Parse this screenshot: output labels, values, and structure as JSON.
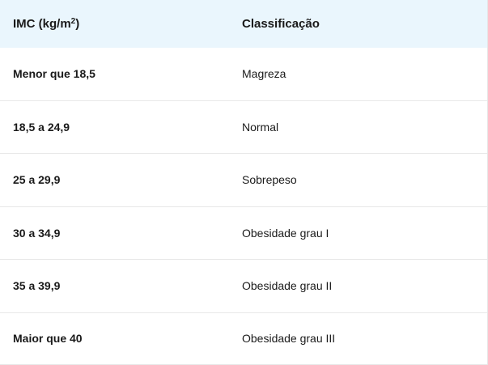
{
  "table": {
    "header": {
      "imc_prefix": "IMC (kg/m",
      "imc_superscript": "2",
      "imc_suffix": ")",
      "classification": "Classificação"
    },
    "rows": [
      {
        "imc": "Menor que 18,5",
        "classification": "Magreza"
      },
      {
        "imc": "18,5 a 24,9",
        "classification": "Normal"
      },
      {
        "imc": "25 a 29,9",
        "classification": "Sobrepeso"
      },
      {
        "imc": "30 a 34,9",
        "classification": "Obesidade grau I"
      },
      {
        "imc": "35 a 39,9",
        "classification": "Obesidade grau II"
      },
      {
        "imc": "Maior que 40",
        "classification": "Obesidade grau III"
      }
    ]
  }
}
